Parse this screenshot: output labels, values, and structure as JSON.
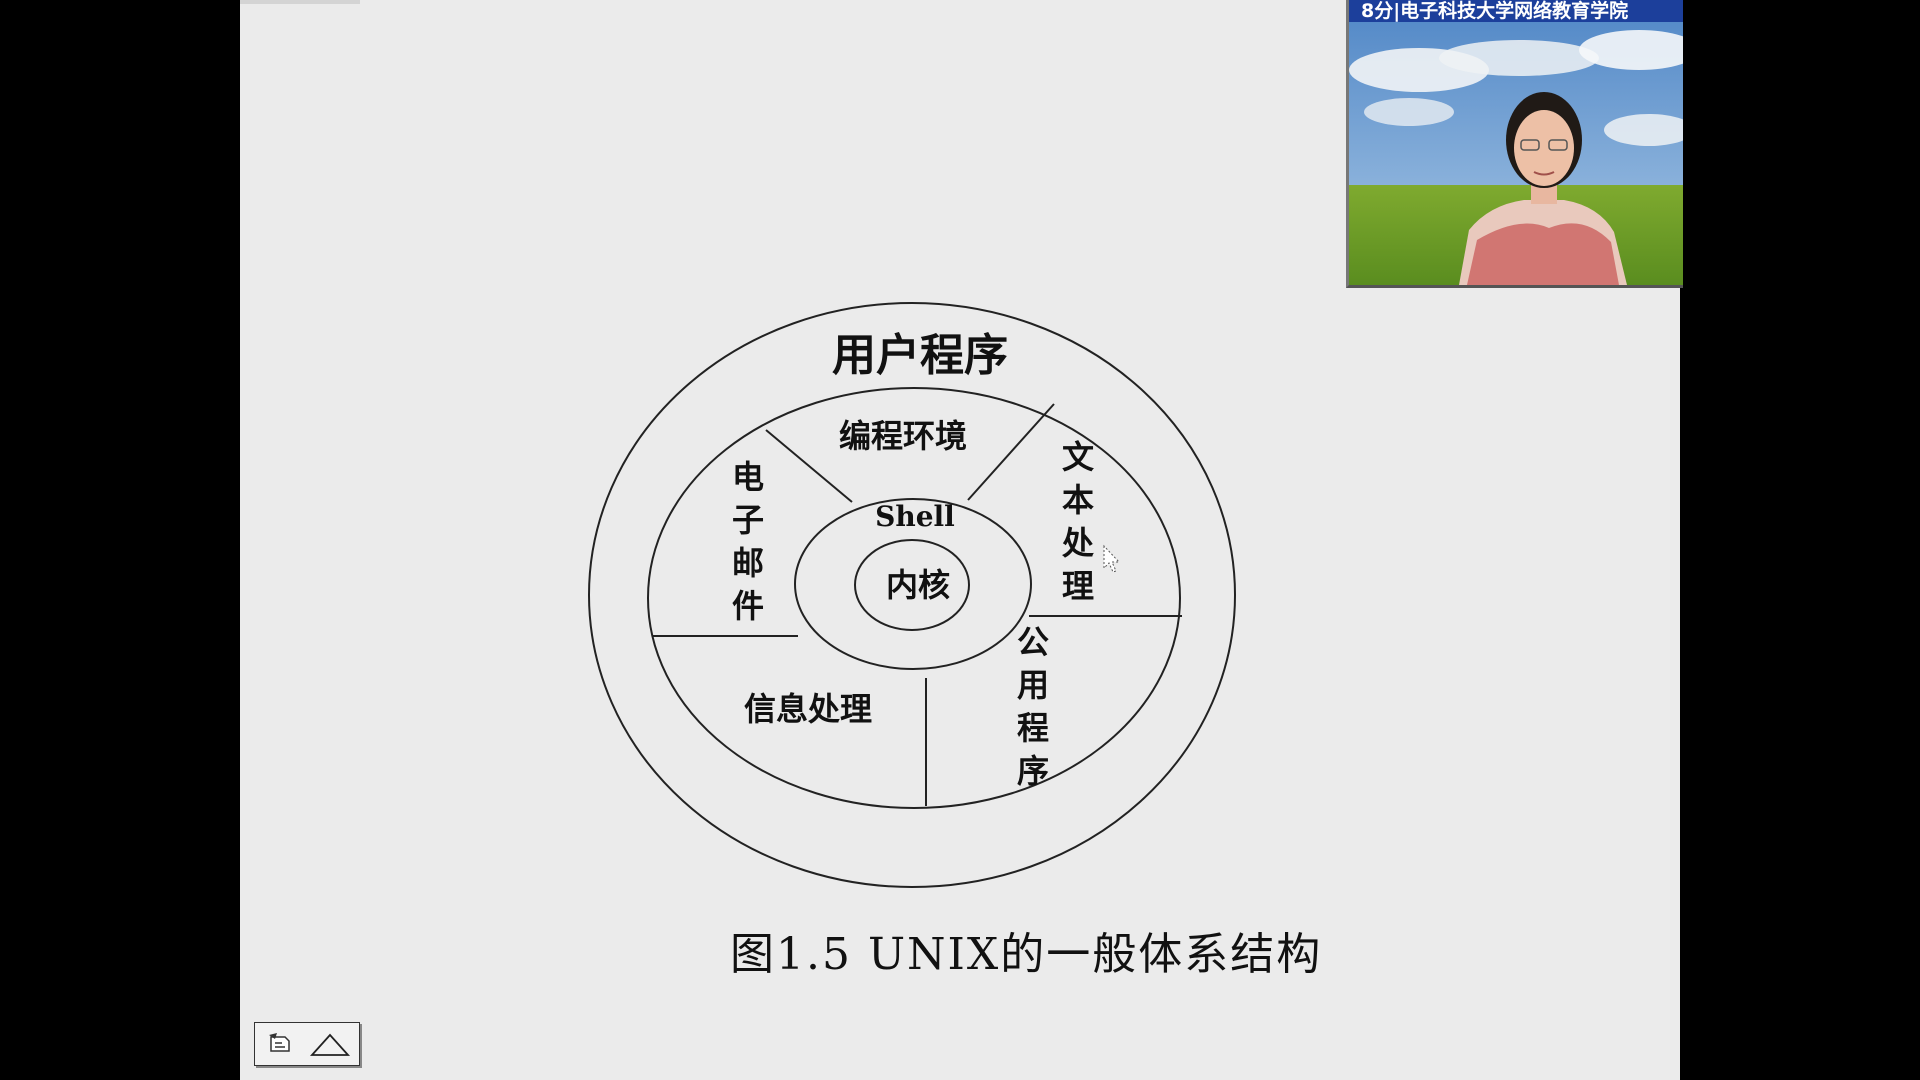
{
  "diagram": {
    "outer_label": "用户程序",
    "segments": {
      "top": "编程环境",
      "left": [
        "电",
        "子",
        "邮",
        "件"
      ],
      "right_top": [
        "文",
        "本",
        "处",
        "理"
      ],
      "bottom_left": "信息处理",
      "bottom_right": [
        "公",
        "用",
        "程",
        "序"
      ]
    },
    "shell_label": "Shell",
    "kernel_label": "内核"
  },
  "caption": "图1.5 UNIX的一般体系结构",
  "video": {
    "banner": "8分|电子科技大学网络教育学院"
  },
  "icons": {
    "nav_prev": "slide-back-icon",
    "nav_next": "triangle-up-icon"
  }
}
